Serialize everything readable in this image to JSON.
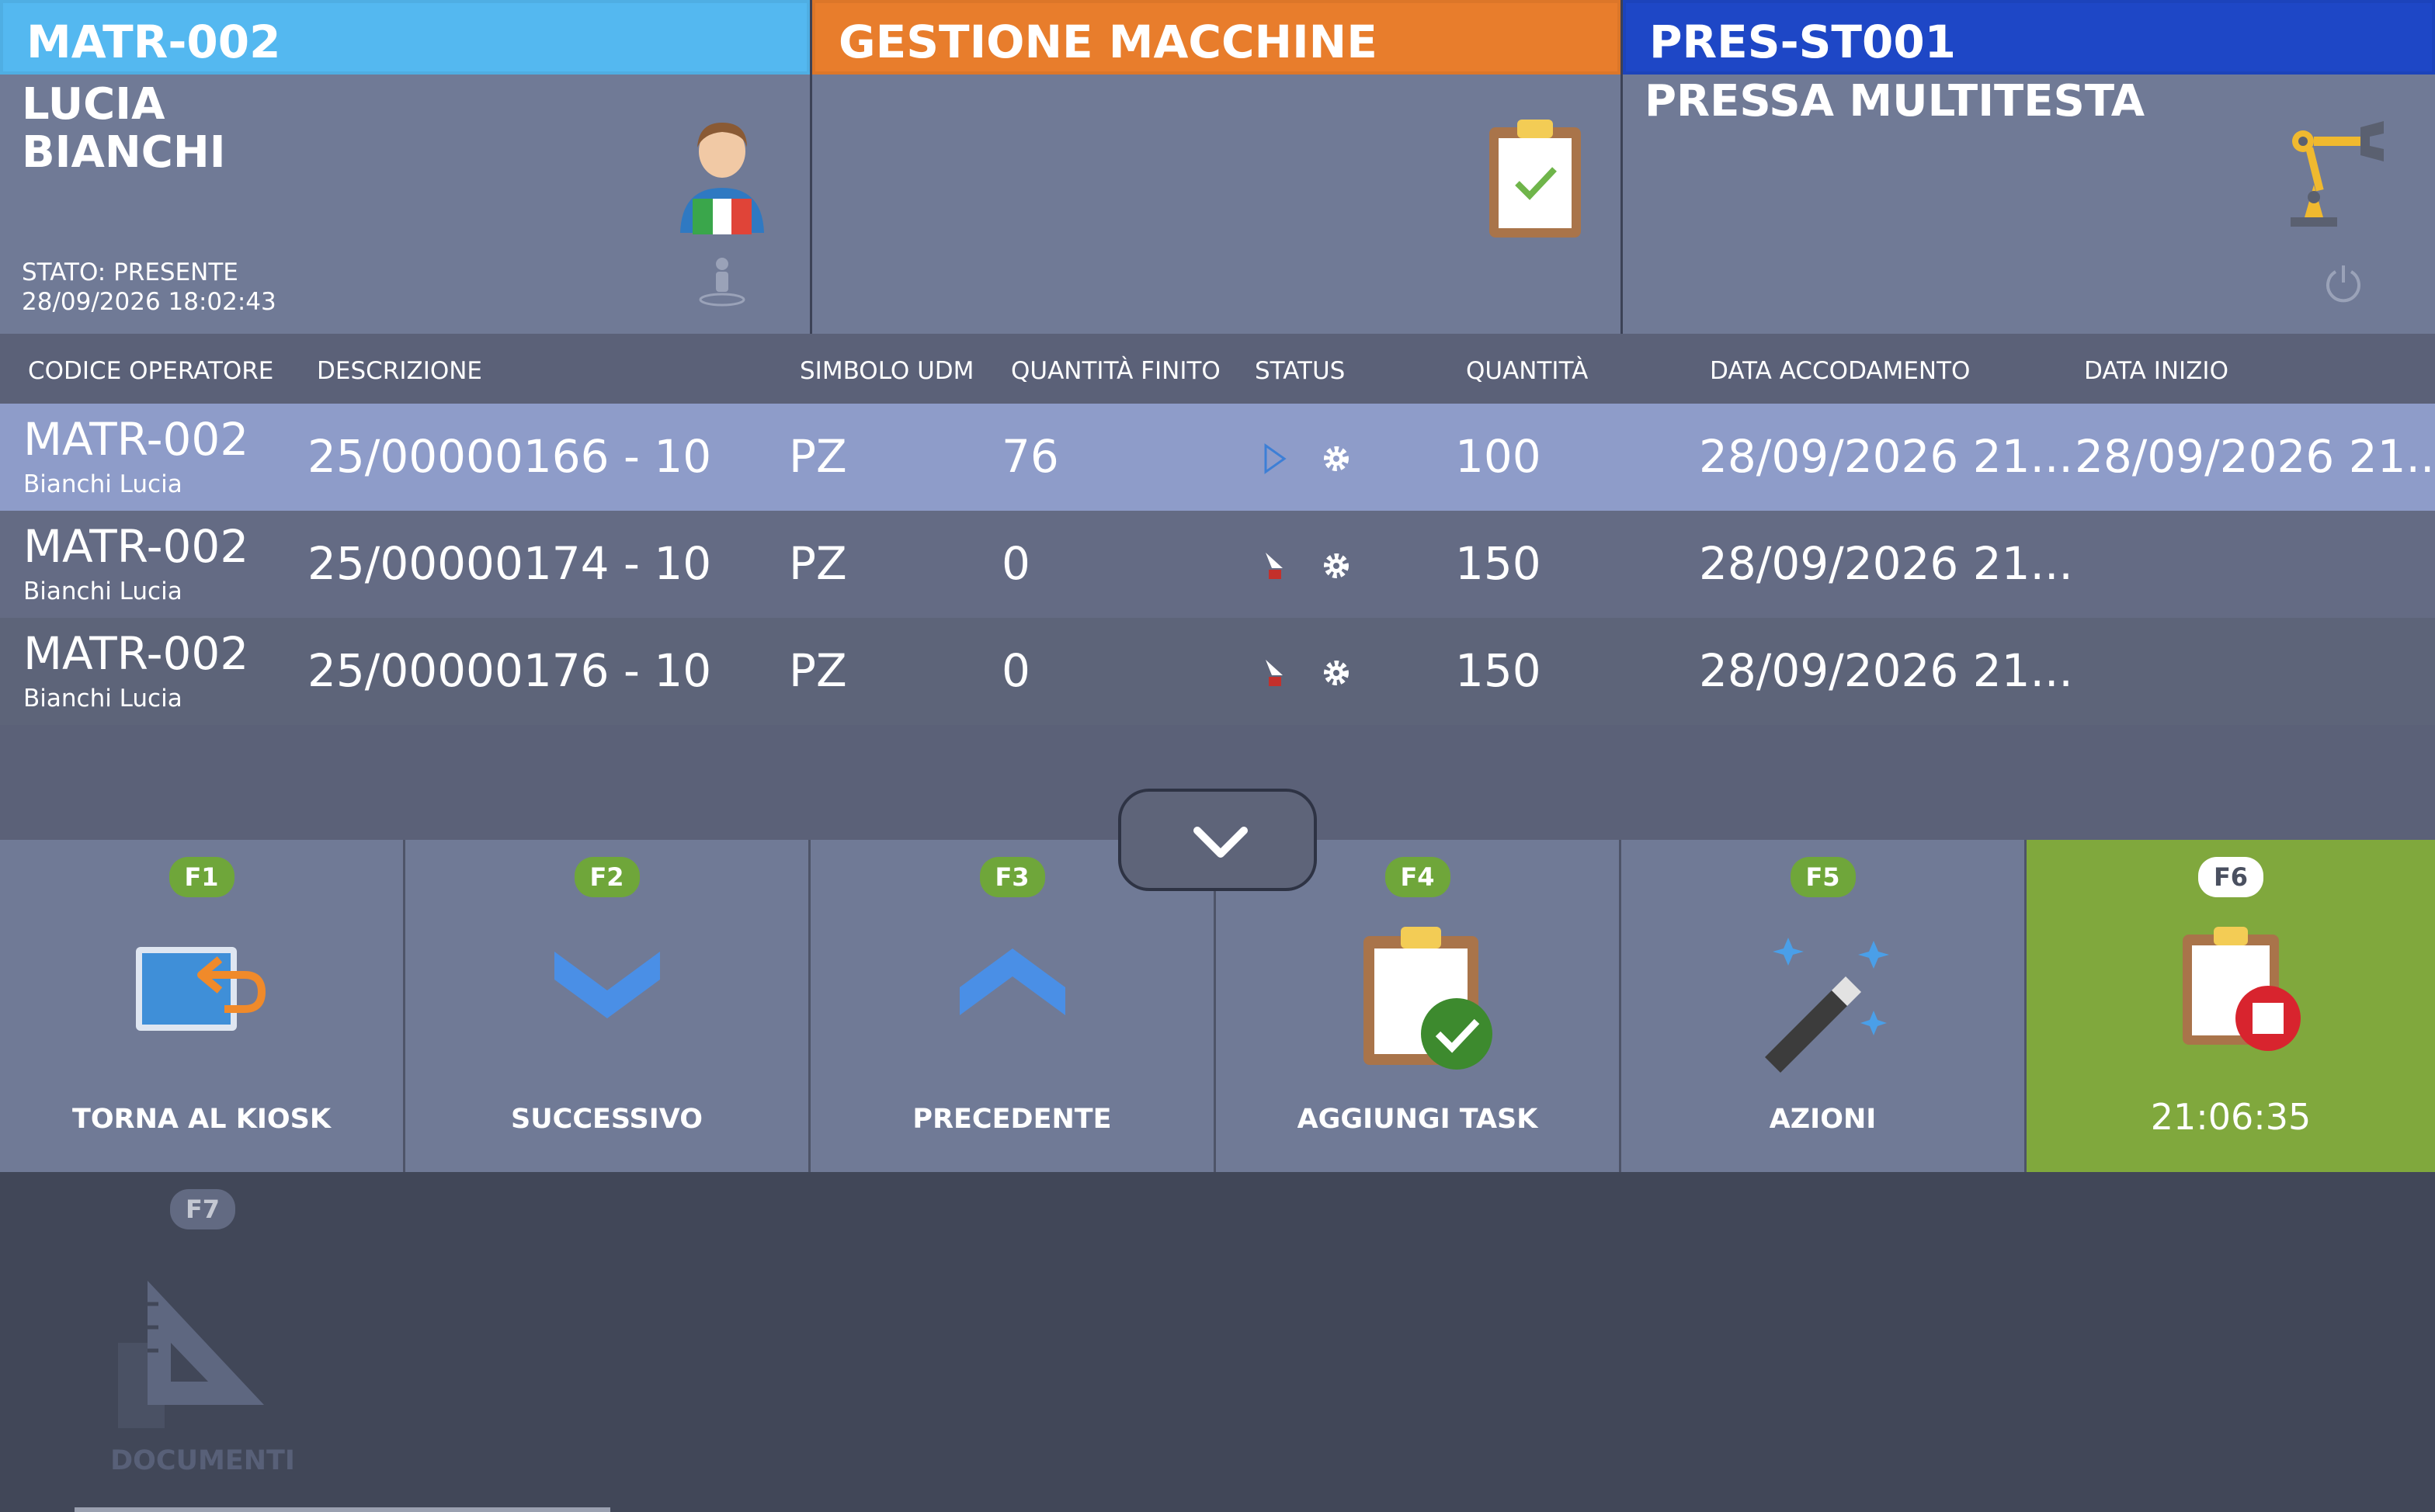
{
  "header": {
    "operator": {
      "code": "MATR-002",
      "first_name": "LUCIA",
      "last_name": "BIANCHI",
      "stato": "STATO: PRESENTE",
      "timestamp": "28/09/2026 18:02:43",
      "band_color": "#54b8f0"
    },
    "management": {
      "title": "GESTIONE MACCHINE",
      "band_color": "#e87d2c"
    },
    "machine": {
      "code": "PRES-ST001",
      "name": "PRESSA MULTITESTA",
      "band_color": "#1e47c6"
    }
  },
  "table": {
    "columns": [
      "CODICE OPERATORE",
      "DESCRIZIONE",
      "SIMBOLO UDM",
      "QUANTITÀ FINITO",
      "STATUS",
      "QUANTITÀ",
      "DATA ACCODAMENTO",
      "DATA INIZIO"
    ],
    "rows": [
      {
        "operator": "MATR-002",
        "operator_name": "Bianchi Lucia",
        "description": "25/00000166 - 10",
        "udm": "PZ",
        "qty_finished": "76",
        "status": "running",
        "qty": "100",
        "data_accodamento": "28/09/2026 21...",
        "data_inizio": "28/09/2026 21..."
      },
      {
        "operator": "MATR-002",
        "operator_name": "Bianchi Lucia",
        "description": "25/00000174 - 10",
        "udm": "PZ",
        "qty_finished": "0",
        "status": "queued",
        "qty": "150",
        "data_accodamento": "28/09/2026 21...",
        "data_inizio": ""
      },
      {
        "operator": "MATR-002",
        "operator_name": "Bianchi Lucia",
        "description": "25/00000176 - 10",
        "udm": "PZ",
        "qty_finished": "0",
        "status": "queued",
        "qty": "150",
        "data_accodamento": "28/09/2026 21...",
        "data_inizio": ""
      }
    ]
  },
  "function_keys": [
    {
      "key": "F1",
      "label": "TORNA AL KIOSK",
      "icon": "return-to-kiosk-icon"
    },
    {
      "key": "F2",
      "label": "SUCCESSIVO",
      "icon": "chevron-down-icon"
    },
    {
      "key": "F3",
      "label": "PRECEDENTE",
      "icon": "chevron-up-icon"
    },
    {
      "key": "F4",
      "label": "AGGIUNGI TASK",
      "icon": "clipboard-check-icon"
    },
    {
      "key": "F5",
      "label": "AZIONI",
      "icon": "magic-wand-icon"
    },
    {
      "key": "F6",
      "label": "21:06:35",
      "icon": "clipboard-stop-icon"
    },
    {
      "key": "F7",
      "label": "DOCUMENTI",
      "icon": "set-square-icon"
    }
  ],
  "colors": {
    "accent_green": "#80a83d",
    "selected_row": "#8e9cc9",
    "panel": "#707a96"
  }
}
